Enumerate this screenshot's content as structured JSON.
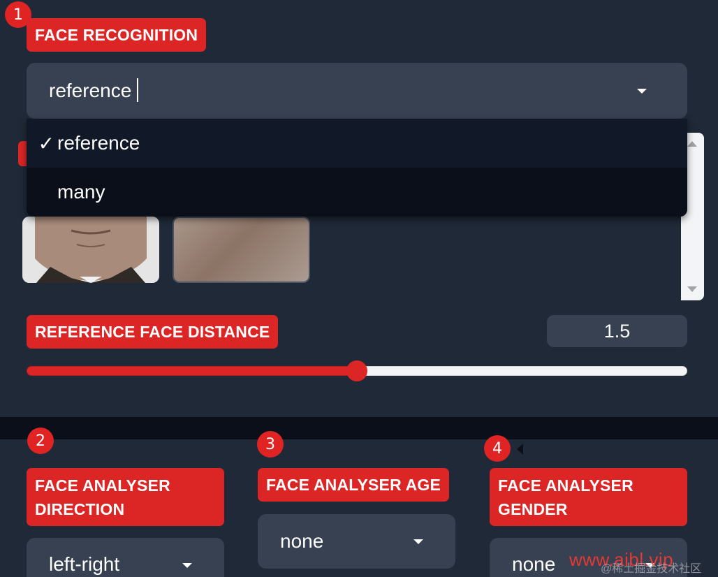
{
  "section1": {
    "badge": "1",
    "label": "FACE RECOGNITION",
    "select_value": "reference",
    "options": [
      {
        "check": "✓",
        "label": "reference",
        "selected": true
      },
      {
        "check": "",
        "label": "many",
        "selected": false
      }
    ]
  },
  "distance": {
    "label": "REFERENCE FACE DISTANCE",
    "value": "1.5",
    "fraction": 0.5
  },
  "section2": {
    "badge": "2",
    "label_line1": "FACE ANALYSER",
    "label_line2": "DIRECTION",
    "select_value": "left-right"
  },
  "section3": {
    "badge": "3",
    "label": "FACE ANALYSER AGE",
    "select_value": "none"
  },
  "section4": {
    "badge": "4",
    "label_line1": "FACE ANALYSER",
    "label_line2": "GENDER",
    "select_value": "none"
  },
  "watermark": {
    "text": "www.aibl.vip",
    "sub": "@稀土掘金技术社区"
  },
  "colors": {
    "accent": "#dc2626",
    "panel": "#1f2937",
    "field": "#374151"
  },
  "icons": [
    "caret-down-icon",
    "checkmark-icon",
    "scroll-up-icon",
    "scroll-down-icon"
  ]
}
